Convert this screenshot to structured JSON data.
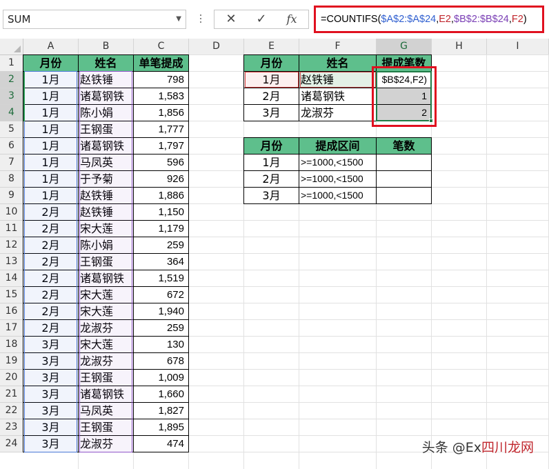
{
  "formula_bar": {
    "name_box": "SUM",
    "cancel_icon": "✕",
    "enter_icon": "✓",
    "fx_label": "fx",
    "formula": {
      "p1": "=COUNTIFS(",
      "p2": "$A$2:$A$24",
      "p3": ",",
      "p4": "E2",
      "p5": ",",
      "p6": "$B$2:$B$24",
      "p7": ",",
      "p8": "F2",
      "p9": ")"
    }
  },
  "columns": [
    "A",
    "B",
    "C",
    "D",
    "E",
    "F",
    "G",
    "H",
    "I"
  ],
  "rows": [
    "1",
    "2",
    "3",
    "4",
    "5",
    "6",
    "7",
    "8",
    "9",
    "10",
    "11",
    "12",
    "13",
    "14",
    "15",
    "16",
    "17",
    "18",
    "19",
    "20",
    "21",
    "22",
    "23",
    "24"
  ],
  "table1": {
    "headers": [
      "月份",
      "姓名",
      "单笔提成"
    ],
    "rows": [
      [
        "1月",
        "赵铁锤",
        "798"
      ],
      [
        "1月",
        "诸葛钢铁",
        "1,583"
      ],
      [
        "1月",
        "陈小娟",
        "1,856"
      ],
      [
        "1月",
        "王钢蛋",
        "1,777"
      ],
      [
        "1月",
        "诸葛钢铁",
        "1,797"
      ],
      [
        "1月",
        "马凤英",
        "596"
      ],
      [
        "1月",
        "于予菊",
        "926"
      ],
      [
        "1月",
        "赵铁锤",
        "1,886"
      ],
      [
        "2月",
        "赵铁锤",
        "1,150"
      ],
      [
        "2月",
        "宋大莲",
        "1,179"
      ],
      [
        "2月",
        "陈小娟",
        "259"
      ],
      [
        "2月",
        "王钢蛋",
        "364"
      ],
      [
        "2月",
        "诸葛钢铁",
        "1,519"
      ],
      [
        "2月",
        "宋大莲",
        "672"
      ],
      [
        "2月",
        "宋大莲",
        "1,940"
      ],
      [
        "2月",
        "龙淑芬",
        "259"
      ],
      [
        "3月",
        "宋大莲",
        "130"
      ],
      [
        "3月",
        "龙淑芬",
        "678"
      ],
      [
        "3月",
        "王钢蛋",
        "1,009"
      ],
      [
        "3月",
        "诸葛钢铁",
        "1,660"
      ],
      [
        "3月",
        "马凤英",
        "1,827"
      ],
      [
        "3月",
        "王钢蛋",
        "1,895"
      ],
      [
        "3月",
        "龙淑芬",
        "474"
      ]
    ]
  },
  "table2": {
    "headers": [
      "月份",
      "姓名",
      "提成笔数"
    ],
    "rows": [
      [
        "1月",
        "赵铁锤",
        "$B$24,F2)"
      ],
      [
        "2月",
        "诸葛钢铁",
        "1"
      ],
      [
        "3月",
        "龙淑芬",
        "2"
      ]
    ]
  },
  "table3": {
    "headers": [
      "月份",
      "提成区间",
      "笔数"
    ],
    "rows": [
      [
        "1月",
        ">=1000,<1500",
        ""
      ],
      [
        "2月",
        ">=1000,<1500",
        ""
      ],
      [
        "3月",
        ">=1000,<1500",
        ""
      ]
    ]
  },
  "watermark": {
    "prefix": "头条 @Ex",
    "highlight": "四川龙网",
    "suffix": ""
  },
  "colors": {
    "header_fill": "#5ebf8c",
    "highlight_border": "#e0101f",
    "range_blue": "#2f5fd0",
    "range_purple": "#7a3fb5",
    "ref_red": "#c0262d"
  }
}
